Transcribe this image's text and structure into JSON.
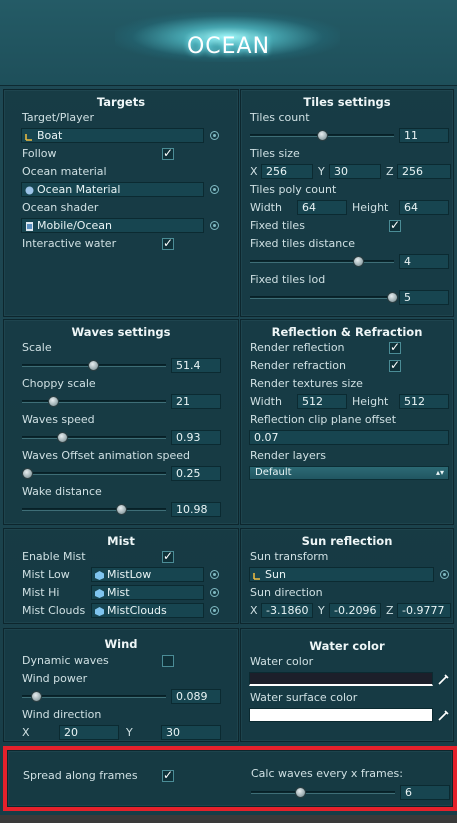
{
  "header": {
    "logo_text": "OCEAN"
  },
  "targets": {
    "title": "Targets",
    "target_label": "Target/Player",
    "target_value": "Boat",
    "follow_label": "Follow",
    "follow_checked": true,
    "material_label": "Ocean material",
    "material_value": "Ocean Material",
    "shader_label": "Ocean shader",
    "shader_value": "Mobile/Ocean",
    "interactive_label": "Interactive water",
    "interactive_checked": true
  },
  "tiles": {
    "title": "Tiles settings",
    "count_label": "Tiles count",
    "count_value": "11",
    "count_level": 0.5,
    "size_label": "Tiles size",
    "x_label": "X",
    "x_value": "256",
    "y_label": "Y",
    "y_value": "30",
    "z_label": "Z",
    "z_value": "256",
    "poly_label": "Tiles poly count",
    "width_label": "Width",
    "width_value": "64",
    "height_label": "Height",
    "height_value": "64",
    "fixed_label": "Fixed tiles",
    "fixed_checked": true,
    "fixed_dist_label": "Fixed tiles distance",
    "fixed_dist_value": "4",
    "fixed_lod_label": "Fixed tiles lod",
    "fixed_lod_value": "5"
  },
  "waves": {
    "title": "Waves settings",
    "scale_label": "Scale",
    "scale_value": "51.4",
    "choppy_label": "Choppy scale",
    "choppy_value": "21",
    "speed_label": "Waves speed",
    "speed_value": "0.93",
    "offset_label": "Waves Offset animation speed",
    "offset_value": "0.25",
    "wake_label": "Wake distance",
    "wake_value": "10.98"
  },
  "reflection": {
    "title": "Reflection & Refraction",
    "reflection_label": "Render reflection",
    "reflection_checked": true,
    "refraction_label": "Render refraction",
    "refraction_checked": true,
    "tex_label": "Render textures size",
    "width_label": "Width",
    "width_value": "512",
    "height_label": "Height",
    "height_value": "512",
    "clip_label": "Reflection clip plane offset",
    "clip_value": "0.07",
    "layers_label": "Render layers",
    "layers_value": "Default"
  },
  "mist": {
    "title": "Mist",
    "enable_label": "Enable Mist",
    "enable_checked": true,
    "low_label": "Mist Low",
    "low_value": "MistLow",
    "hi_label": "Mist Hi",
    "hi_value": "Mist",
    "clouds_label": "Mist Clouds",
    "clouds_value": "MistClouds"
  },
  "sun": {
    "title": "Sun reflection",
    "transform_label": "Sun transform",
    "transform_value": "Sun",
    "direction_label": "Sun direction",
    "x_label": "X",
    "x_value": "-3.1860",
    "y_label": "Y",
    "y_value": "-0.2096",
    "z_label": "Z",
    "z_value": "-0.9777"
  },
  "wind": {
    "title": "Wind",
    "dynamic_label": "Dynamic waves",
    "dynamic_checked": false,
    "power_label": "Wind power",
    "power_value": "0.089",
    "direction_label": "Wind direction",
    "x_label": "X",
    "x_value": "20",
    "y_label": "Y",
    "y_value": "30"
  },
  "water": {
    "title": "Water color",
    "color_label": "Water color",
    "color_hex": "#1c1f2a",
    "surface_label": "Water surface color",
    "surface_hex": "#ffffff"
  },
  "frames": {
    "spread_label": "Spread along frames",
    "spread_checked": true,
    "calc_label": "Calc waves every x frames:",
    "calc_value": "6"
  }
}
